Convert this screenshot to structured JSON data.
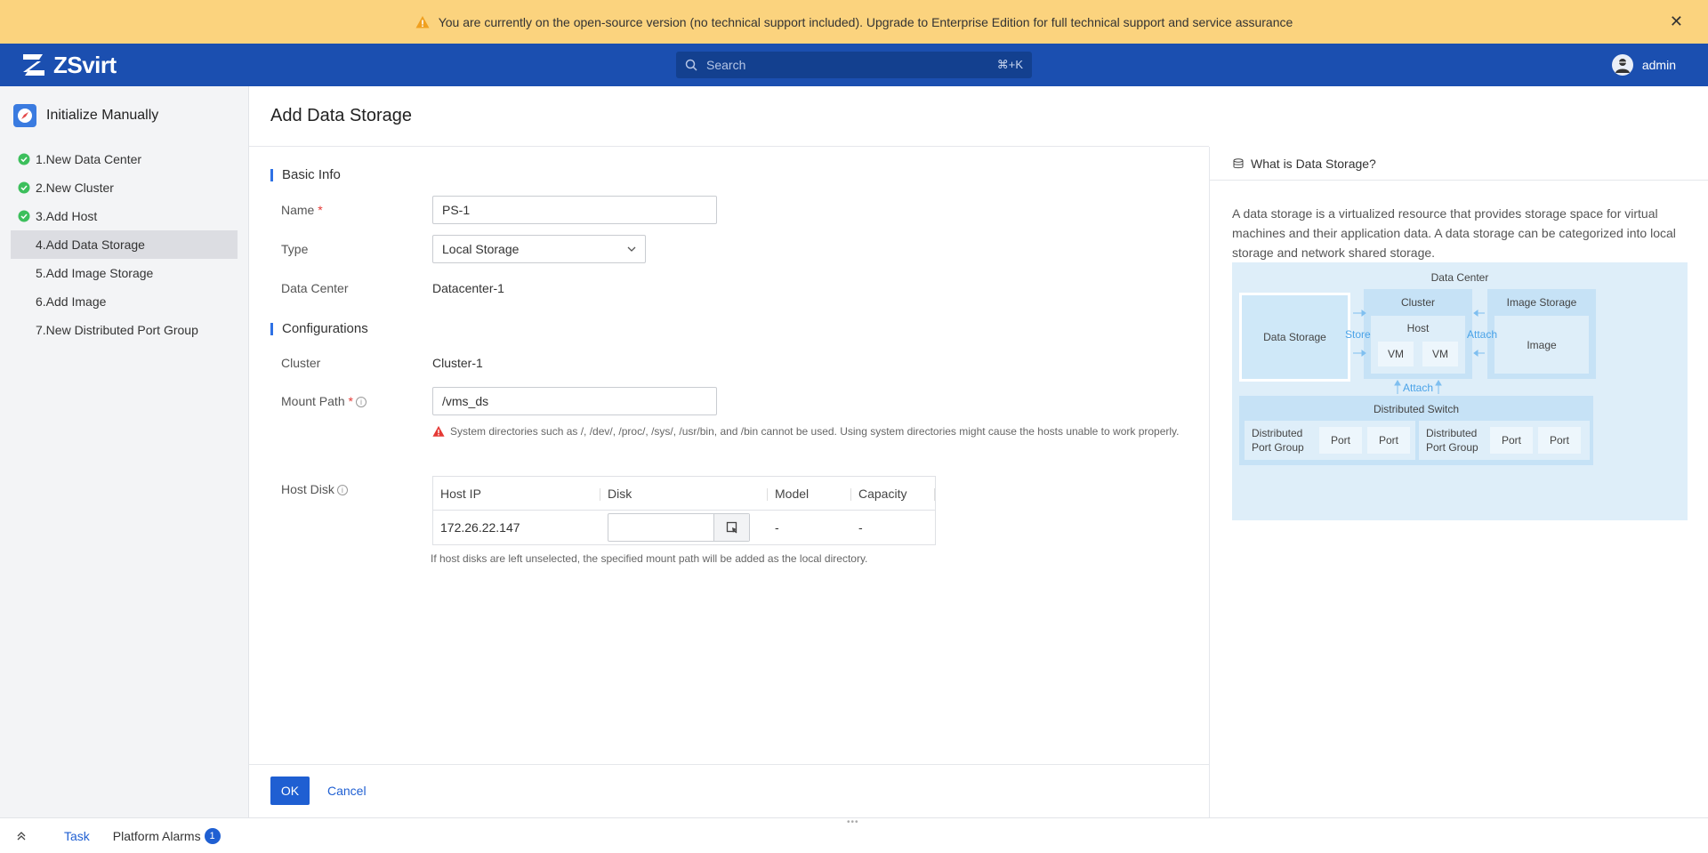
{
  "banner": {
    "message": "You are currently on the open-source version (no technical support included). Upgrade to Enterprise Edition for full technical support and service assurance",
    "close_icon": "close-icon"
  },
  "topbar": {
    "brand": "ZSvirt",
    "search_placeholder": "Search",
    "search_shortcut": "⌘+K",
    "username": "admin"
  },
  "sidebar": {
    "title": "Initialize Manually",
    "steps": [
      {
        "label": "1.New Data Center",
        "done": true
      },
      {
        "label": "2.New Cluster",
        "done": true
      },
      {
        "label": "3.Add Host",
        "done": true
      },
      {
        "label": "4.Add Data Storage",
        "done": false,
        "active": true
      },
      {
        "label": "5.Add Image Storage",
        "done": false
      },
      {
        "label": "6.Add Image",
        "done": false
      },
      {
        "label": "7.New Distributed Port Group",
        "done": false
      }
    ]
  },
  "form": {
    "title": "Add Data Storage",
    "basic_info": "Basic Info",
    "name_label": "Name",
    "name_value": "PS-1",
    "type_label": "Type",
    "type_value": "Local Storage",
    "dc_label": "Data Center",
    "dc_value": "Datacenter-1",
    "configurations": "Configurations",
    "cluster_label": "Cluster",
    "cluster_value": "Cluster-1",
    "mount_label": "Mount Path",
    "mount_value": "/vms_ds",
    "mount_warning": "System directories such as /, /dev/, /proc/, /sys/, /usr/bin, and /bin cannot be used. Using system directories might cause the hosts unable to work properly.",
    "host_disk_label": "Host Disk",
    "table": {
      "headers": [
        "Host IP",
        "Disk",
        "Model",
        "Capacity"
      ],
      "rows": [
        {
          "host_ip": "172.26.22.147",
          "disk": "",
          "model": "-",
          "capacity": "-"
        }
      ]
    },
    "hint": "If host disks are left unselected, the specified mount path will be added as the local directory.",
    "ok_label": "OK",
    "cancel_label": "Cancel"
  },
  "help": {
    "title": "What is Data Storage?",
    "description": "A data storage is a virtualized resource that provides storage space for virtual machines and their application data. A data storage can be categorized into local storage and network shared storage.",
    "diagram": {
      "data_center": "Data Center",
      "data_storage": "Data Storage",
      "cluster": "Cluster",
      "host": "Host",
      "vm1": "VM",
      "vm2": "VM",
      "image_storage": "Image Storage",
      "image": "Image",
      "store": "Store",
      "attach1": "Attach",
      "attach2": "Attach",
      "distributed_switch": "Distributed Switch",
      "dpg1": "Distributed Port Group",
      "dpg2": "Distributed Port Group",
      "port": "Port"
    }
  },
  "bottombar": {
    "task": "Task",
    "alarms": "Platform Alarms",
    "alarm_count": "1"
  },
  "colors": {
    "banner": "#fbd37e",
    "topbar": "#1b4fb0",
    "primary": "#1f5fd2",
    "success": "#3cbf5c",
    "danger": "#e53935"
  }
}
